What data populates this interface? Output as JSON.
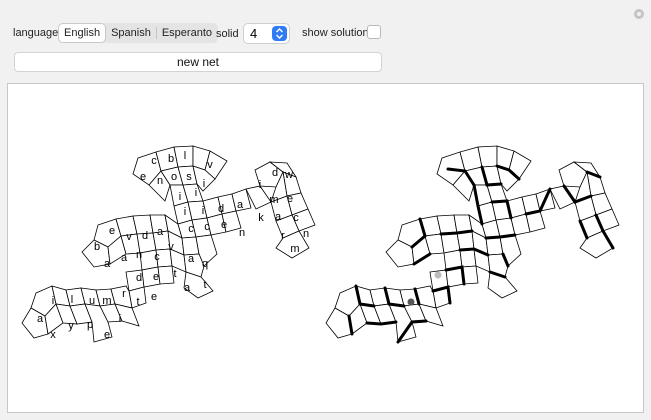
{
  "controls": {
    "language_label": "language",
    "languages": [
      "English",
      "Spanish",
      "Esperanto"
    ],
    "selected_language": "English",
    "solid_label": "solid",
    "solid_value": "4",
    "solution_label": "show solution",
    "show_solution": false,
    "new_net_label": "new net"
  },
  "colors": {
    "accent": "#2f7bf6",
    "dot_dark": "#555555",
    "dot_light": "#bbbbbb"
  },
  "letter_net": {
    "letters": [
      {
        "ch": "c"
      },
      {
        "ch": "b"
      },
      {
        "ch": "l"
      },
      {
        "ch": "v"
      },
      {
        "ch": "e"
      },
      {
        "ch": "n"
      },
      {
        "ch": "o"
      },
      {
        "ch": "s"
      },
      {
        "ch": "i"
      },
      {
        "ch": "i"
      },
      {
        "ch": "i"
      },
      {
        "ch": "d"
      },
      {
        "ch": "w"
      },
      {
        "ch": "i"
      },
      {
        "ch": "m"
      },
      {
        "ch": "e"
      },
      {
        "ch": "i"
      },
      {
        "ch": "i"
      },
      {
        "ch": "d"
      },
      {
        "ch": "a"
      },
      {
        "ch": "k"
      },
      {
        "ch": "a"
      },
      {
        "ch": "c"
      },
      {
        "ch": "n"
      },
      {
        "ch": "r"
      },
      {
        "ch": "m"
      },
      {
        "ch": "e"
      },
      {
        "ch": "v"
      },
      {
        "ch": "d"
      },
      {
        "ch": "a"
      },
      {
        "ch": "c"
      },
      {
        "ch": "c"
      },
      {
        "ch": "e"
      },
      {
        "ch": "n"
      },
      {
        "ch": "b"
      },
      {
        "ch": "a"
      },
      {
        "ch": "a"
      },
      {
        "ch": "n"
      },
      {
        "ch": "c"
      },
      {
        "ch": "v"
      },
      {
        "ch": "a"
      },
      {
        "ch": "q"
      },
      {
        "ch": "d"
      },
      {
        "ch": "e"
      },
      {
        "ch": "t"
      },
      {
        "ch": "a"
      },
      {
        "ch": "t"
      },
      {
        "ch": "r"
      },
      {
        "ch": "t"
      },
      {
        "ch": "e"
      },
      {
        "ch": "i"
      },
      {
        "ch": "l"
      },
      {
        "ch": "u"
      },
      {
        "ch": "m"
      },
      {
        "ch": "a"
      },
      {
        "ch": "x"
      },
      {
        "ch": "y"
      },
      {
        "ch": "p"
      },
      {
        "ch": "e"
      },
      {
        "ch": "i"
      }
    ]
  }
}
